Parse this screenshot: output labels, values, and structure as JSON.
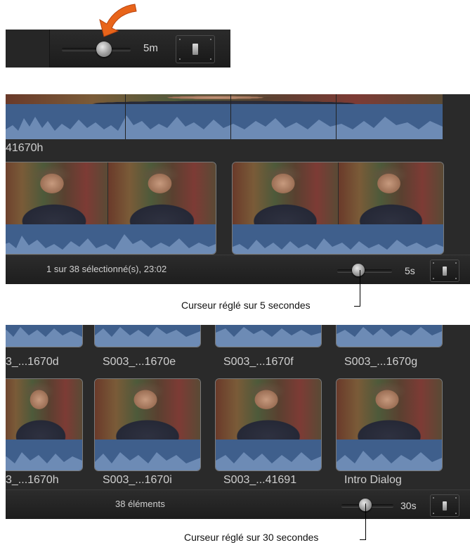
{
  "top_control": {
    "zoom_label": "5m"
  },
  "panel_one": {
    "group_label": "41670h",
    "status": "1 sur 38 sélectionné(s), 23:02",
    "zoom_label": "5s"
  },
  "caption_one": "Curseur réglé sur 5 secondes",
  "panel_two": {
    "row1_names": [
      "3_...1670d",
      "S003_...1670e",
      "S003_...1670f",
      "S003_...1670g"
    ],
    "row2_names": [
      "3_...1670h",
      "S003_...1670i",
      "S003_...41691",
      "Intro Dialog"
    ],
    "status": "38 éléments",
    "zoom_label": "30s"
  },
  "caption_two": "Curseur réglé sur 30 secondes",
  "colors": {
    "arrow": "#e8641a",
    "waveform": "#3f5f8c",
    "panel_bg": "#2a2a2a"
  },
  "icons": [
    "callout-arrow-icon",
    "slider-knob-icon",
    "clip-appearance-icon"
  ]
}
